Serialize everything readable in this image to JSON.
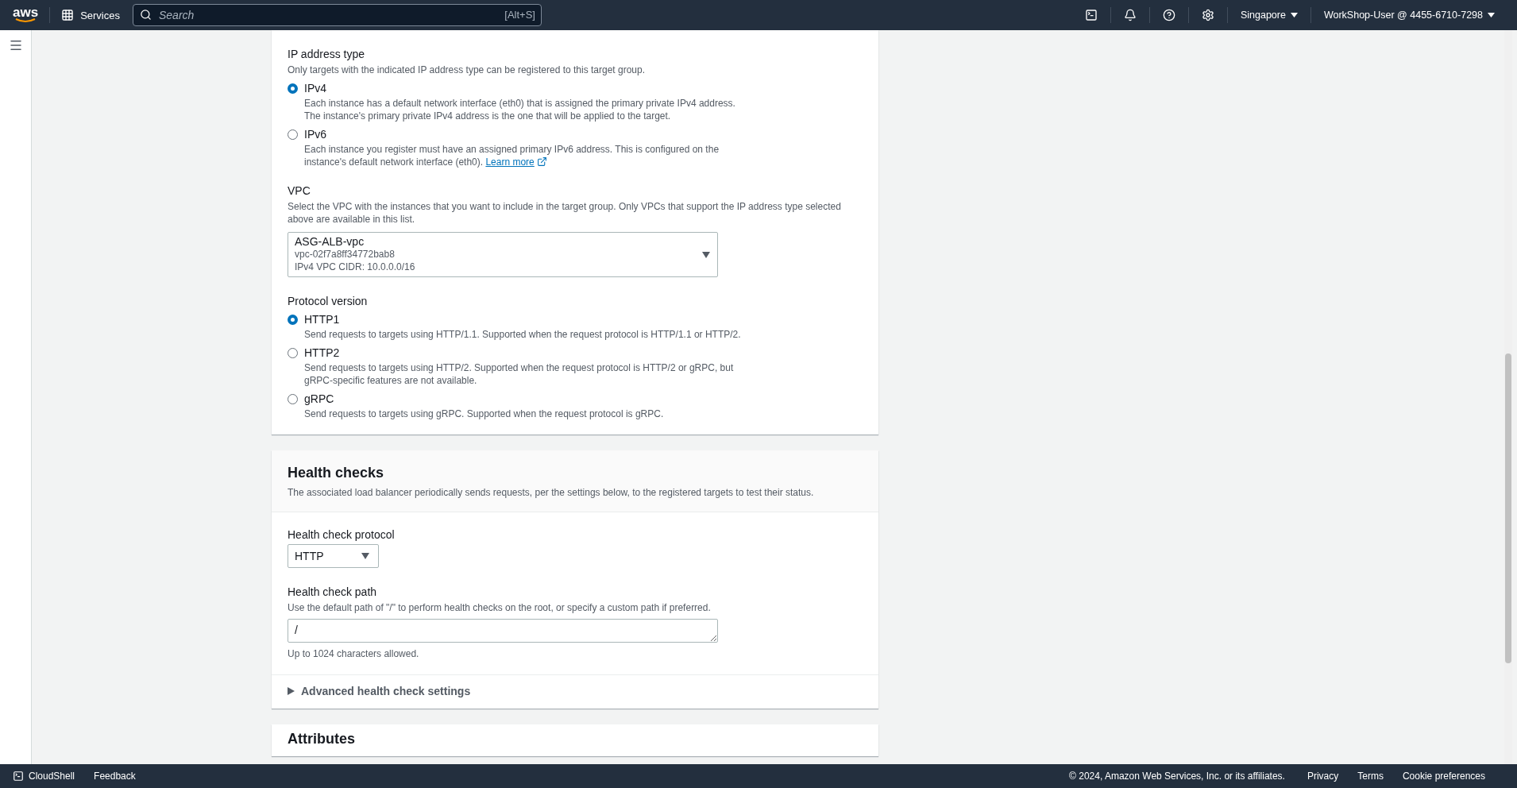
{
  "top_nav": {
    "logo": "aws",
    "services": "Services",
    "search": {
      "placeholder": "Search",
      "shortcut": "[Alt+S]"
    },
    "region": "Singapore",
    "account": "WorkShop-User @ 4455-6710-7298"
  },
  "ip_address_type": {
    "label": "IP address type",
    "description": "Only targets with the indicated IP address type can be registered to this target group.",
    "options": [
      {
        "label": "IPv4",
        "description": "Each instance has a default network interface (eth0) that is assigned the primary private IPv4 address. The instance's primary private IPv4 address is the one that will be applied to the target.",
        "selected": true
      },
      {
        "label": "IPv6",
        "description": "Each instance you register must have an assigned primary IPv6 address. This is configured on the instance's default network interface (eth0).",
        "link": "Learn more",
        "selected": false
      }
    ]
  },
  "vpc": {
    "label": "VPC",
    "description": "Select the VPC with the instances that you want to include in the target group. Only VPCs that support the IP address type selected above are available in this list.",
    "select": {
      "value": "ASG-ALB-vpc",
      "id": "vpc-02f7a8ff34772bab8",
      "cidr": "IPv4 VPC CIDR: 10.0.0.0/16"
    }
  },
  "protocol_version": {
    "label": "Protocol version",
    "options": [
      {
        "label": "HTTP1",
        "description": "Send requests to targets using HTTP/1.1. Supported when the request protocol is HTTP/1.1 or HTTP/2.",
        "selected": true
      },
      {
        "label": "HTTP2",
        "description": "Send requests to targets using HTTP/2. Supported when the request protocol is HTTP/2 or gRPC, but gRPC-specific features are not available.",
        "selected": false
      },
      {
        "label": "gRPC",
        "description": "Send requests to targets using gRPC. Supported when the request protocol is gRPC.",
        "selected": false
      }
    ]
  },
  "health_checks": {
    "title": "Health checks",
    "description": "The associated load balancer periodically sends requests, per the settings below, to the registered targets to test their status.",
    "protocol": {
      "label": "Health check protocol",
      "value": "HTTP"
    },
    "path": {
      "label": "Health check path",
      "description": "Use the default path of \"/\" to perform health checks on the root, or specify a custom path if preferred.",
      "value": "/",
      "hint": "Up to 1024 characters allowed."
    },
    "advanced": {
      "label": "Advanced health check settings",
      "expanded": false
    }
  },
  "attributes": {
    "title": "Attributes"
  },
  "footer": {
    "cloudshell": "CloudShell",
    "feedback": "Feedback",
    "copyright": "© 2024, Amazon Web Services, Inc. or its affiliates.",
    "links": [
      "Privacy",
      "Terms",
      "Cookie preferences"
    ]
  }
}
